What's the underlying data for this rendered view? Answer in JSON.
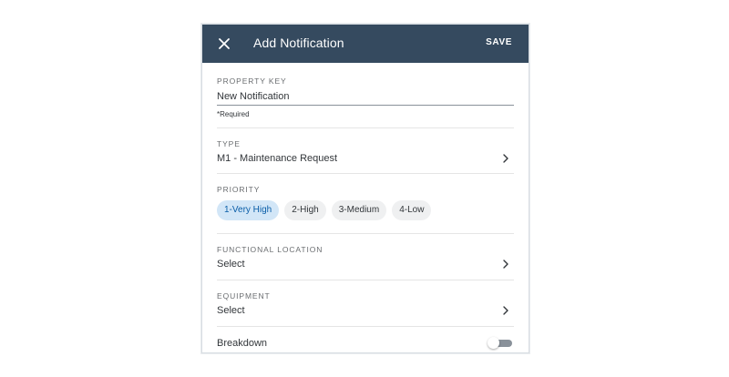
{
  "header": {
    "title": "Add Notification",
    "save_label": "SAVE",
    "close_icon": "close-icon",
    "background": "#354a5f"
  },
  "property_key": {
    "label": "PROPERTY KEY",
    "value": "New Notification",
    "hint": "*Required"
  },
  "type": {
    "label": "TYPE",
    "value": "M1 - Maintenance Request",
    "icon": "chevron-right-icon"
  },
  "priority": {
    "label": "PRIORITY",
    "options": [
      "1-Very High",
      "2-High",
      "3-Medium",
      "4-Low"
    ],
    "selected": "1-Very High",
    "selected_color": "#0a5ea8"
  },
  "functional_location": {
    "label": "FUNCTIONAL LOCATION",
    "value": "Select",
    "icon": "chevron-right-icon"
  },
  "equipment": {
    "label": "EQUIPMENT",
    "value": "Select",
    "icon": "chevron-right-icon"
  },
  "breakdown": {
    "label": "Breakdown",
    "enabled": false
  }
}
